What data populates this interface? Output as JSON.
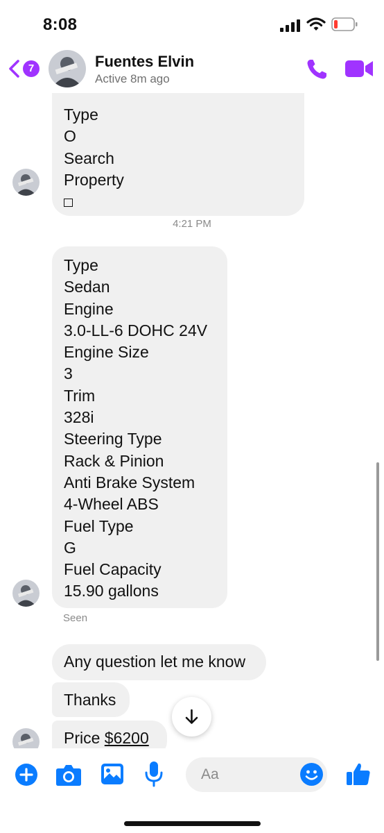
{
  "status_bar": {
    "time": "8:08"
  },
  "header": {
    "unread_count": "7",
    "contact_name": "Fuentes Elvin",
    "status": "Active 8m ago"
  },
  "messages": {
    "bubble_1_lines": [
      "Type",
      "O",
      "Search",
      "Property"
    ],
    "timestamp": "4:21 PM",
    "bubble_2_lines": [
      "Type",
      "Sedan",
      "Engine",
      "3.0-LL-6 DOHC 24V",
      "Engine Size",
      "3",
      "Trim",
      "328i",
      "Steering Type",
      "Rack & Pinion",
      "Anti Brake System",
      "4-Wheel ABS",
      "Fuel Type",
      "G",
      "Fuel Capacity",
      "15.90 gallons"
    ],
    "seen_label": "Seen",
    "msg_question": "Any question let me know",
    "msg_thanks": "Thanks",
    "msg_price_prefix": "Price ",
    "msg_price_value": "$6200"
  },
  "composer": {
    "placeholder": "Aa"
  },
  "icons": [
    "back-chevron-icon",
    "phone-icon",
    "video-camera-icon",
    "plus-icon",
    "camera-icon",
    "gallery-icon",
    "microphone-icon",
    "emoji-icon",
    "thumbs-up-icon",
    "arrow-down-icon"
  ],
  "colors": {
    "accent_purple": "#a033ff",
    "accent_blue": "#0a7cff",
    "bubble_gray": "#f0f0f0",
    "muted_text": "#8a8a8a"
  }
}
